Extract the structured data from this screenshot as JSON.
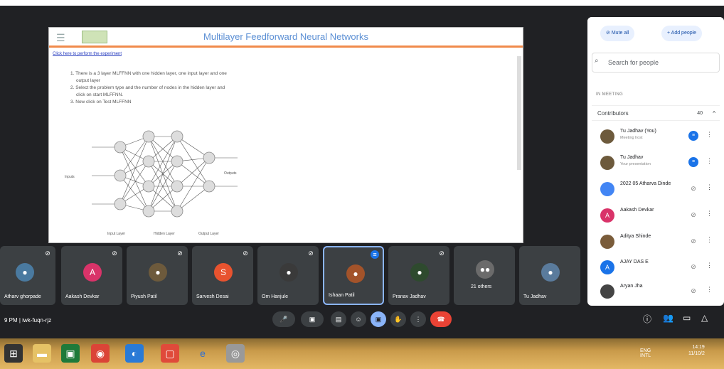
{
  "slide": {
    "title": "Multilayer Feedforward Neural Networks",
    "link": "Click here to perform the experiment",
    "instructions": [
      "1. There is a 3 layer MLFFNN with one hidden layer, one input layer and one",
      "output layer",
      "2. Select the problem type and the number of nodes in the hidden layer and",
      "click on start MLFFNN.",
      "3. Now click on Test MLFFNN"
    ],
    "labels": {
      "input": "Input Layer",
      "hidden": "Hidden Layer",
      "output": "Output Layer",
      "inputs": "Inputs",
      "outputs": "Outputs"
    }
  },
  "tiles": [
    {
      "name": "Atharv ghorpade",
      "initial": "",
      "color": "#4a7aa0"
    },
    {
      "name": "Aakash Devkar",
      "initial": "A",
      "color": "#d93369"
    },
    {
      "name": "Piyush Patil",
      "initial": "",
      "color": "#6d5a3c"
    },
    {
      "name": "Sarvesh Desai",
      "initial": "S",
      "color": "#e8532f"
    },
    {
      "name": "Om Hanjule",
      "initial": "",
      "color": "#3a3a3a"
    },
    {
      "name": "Ishaan Patil",
      "initial": "",
      "color": "#a3532a"
    },
    {
      "name": "Pranav Jadhav",
      "initial": "",
      "color": "#2e4a2e"
    },
    {
      "name": "21 others",
      "initial": "",
      "color": "#6b6b6b"
    },
    {
      "name": "Tu Jadhav",
      "initial": "",
      "color": "#5a7b9c"
    }
  ],
  "meeting": {
    "info": "9 PM  |  iwk-fuqn-rjz"
  },
  "panel": {
    "mute_all": "Mute all",
    "add_people": "Add people",
    "search_placeholder": "Search for people",
    "in_meeting": "IN MEETING",
    "contributors": "Contributors",
    "contributors_count": "40",
    "people": [
      {
        "name": "Tu Jadhav (You)",
        "sub": "Meeting host",
        "color": "#6d5a3c",
        "status": "blue"
      },
      {
        "name": "Tu Jadhav",
        "sub": "Your presentation",
        "color": "#6d5a3c",
        "status": "blue"
      },
      {
        "name": "2022 05 Atharva Dinde",
        "sub": "",
        "color": "#4285f4",
        "status": "mute"
      },
      {
        "name": "Aakash Devkar",
        "sub": "",
        "color": "#d93369",
        "status": "mute"
      },
      {
        "name": "Aditya Shinde",
        "sub": "",
        "color": "#7a5c3a",
        "status": "mute"
      },
      {
        "name": "AJAY DAS E",
        "sub": "",
        "color": "#1a73e8",
        "status": "mute"
      },
      {
        "name": "Aryan Jha",
        "sub": "",
        "color": "#444",
        "status": "mute"
      }
    ]
  },
  "taskbar": {
    "lang": "ENG",
    "region": "INTL",
    "time": "14:19",
    "date": "11/10/2"
  }
}
